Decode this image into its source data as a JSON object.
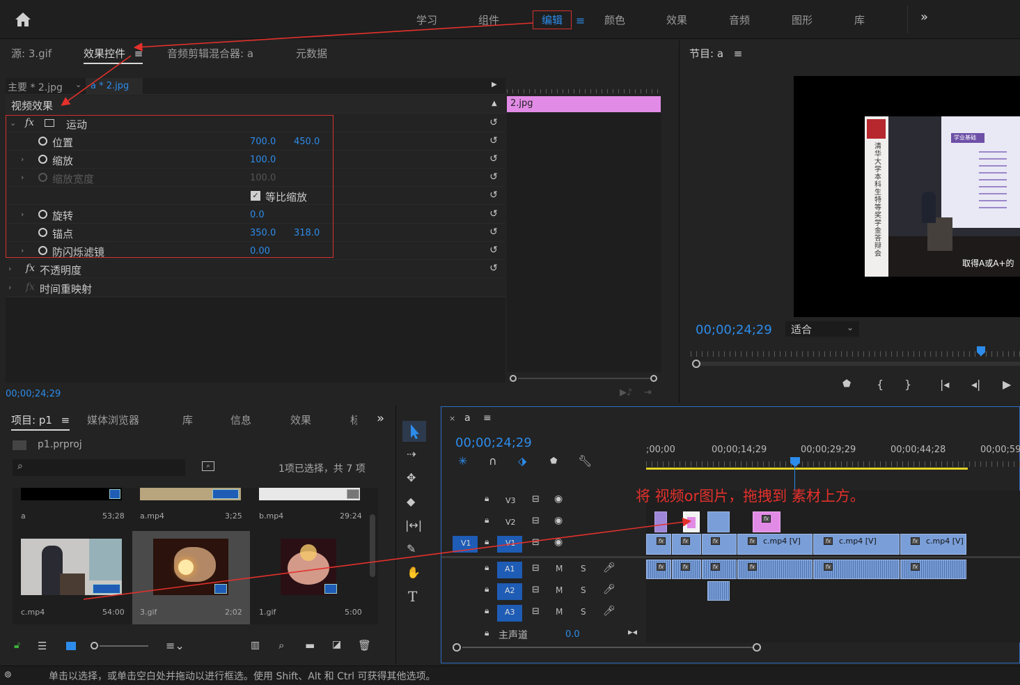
{
  "workspace_tabs": [
    "学习",
    "组件",
    "编辑",
    "颜色",
    "效果",
    "音频",
    "图形",
    "库"
  ],
  "more_glyph": "»",
  "effect_panel": {
    "tabs": [
      "源: 3.gif",
      "效果控件",
      "音频剪辑混合器: a",
      "元数据"
    ],
    "master_label": "主要 * 2.jpg",
    "sequence_clip": "a * 2.jpg",
    "video_effects": "视频效果",
    "clip_bar_label": "2.jpg",
    "motion": "运动",
    "props": [
      {
        "label": "位置",
        "v1": "700.0",
        "v2": "450.0"
      },
      {
        "label": "缩放",
        "v1": "100.0",
        "v2": ""
      },
      {
        "label": "缩放宽度",
        "v1": "100.0",
        "v2": ""
      },
      {
        "label": "等比缩放",
        "v1": "",
        "v2": ""
      },
      {
        "label": "旋转",
        "v1": "0.0",
        "v2": ""
      },
      {
        "label": "锚点",
        "v1": "350.0",
        "v2": "318.0"
      },
      {
        "label": "防闪烁滤镜",
        "v1": "0.00",
        "v2": ""
      }
    ],
    "opacity": "不透明度",
    "time_remap": "时间重映射",
    "timecode": "00;00;24;29"
  },
  "program": {
    "title": "节目: a",
    "timecode": "00;00;24;29",
    "fit": "适合",
    "overlay_text": "取得A或A+的",
    "slide_title": "学业基础",
    "banner": "清华大学本科生特等奖学金答辩会"
  },
  "project": {
    "tabs": [
      "项目: p1",
      "媒体浏览器",
      "库",
      "信息",
      "效果",
      "标"
    ],
    "file": "p1.prproj",
    "selection_info": "1项已选择，共 7 项",
    "items": [
      {
        "name": "a",
        "duration": "53;28"
      },
      {
        "name": "a.mp4",
        "duration": "3;25"
      },
      {
        "name": "b.mp4",
        "duration": "29:24"
      },
      {
        "name": "c.mp4",
        "duration": "54:00"
      },
      {
        "name": "3.gif",
        "duration": "2;02"
      },
      {
        "name": "1.gif",
        "duration": "5:00"
      }
    ]
  },
  "timeline": {
    "seq_name": "a",
    "timecode": "00;00;24;29",
    "ruler": [
      ";00;00",
      "00;00;14;29",
      "00;00;29;29",
      "00;00;44;28",
      "00;00;59;"
    ],
    "tracks": [
      "V3",
      "V2",
      "V1",
      "A1",
      "A2",
      "A3"
    ],
    "v1_src": "V1",
    "master": "主声道",
    "master_val": "0.0",
    "m": "M",
    "s": "S",
    "clip_label": "c.mp4 [V]",
    "annotation": "将 视频or图片，拖拽到 素材上方。"
  },
  "status_bar": "单击以选择，或单击空白处并拖动以进行框选。使用 Shift、Alt 和 Ctrl 可获得其他选项。"
}
